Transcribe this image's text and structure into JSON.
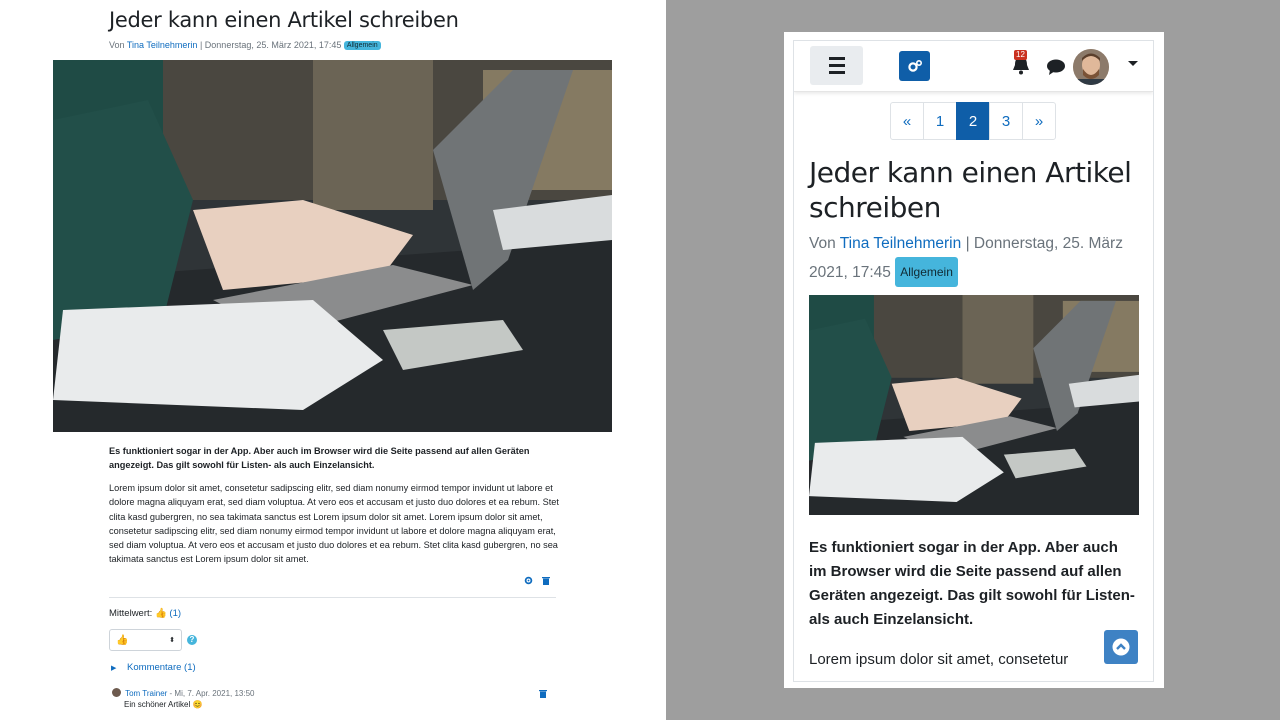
{
  "article": {
    "title": "Jeder kann einen Artikel schreiben",
    "by_prefix": "Von",
    "author": "Tina Teilnehmerin",
    "separator": "|",
    "date": "Donnerstag, 25. März 2021, 17:45",
    "category": "Allgemein",
    "lead": "Es funktioniert sogar in der App. Aber auch im Browser wird die Seite passend auf allen Geräten angezeigt. Das gilt sowohl für Listen- als auch Einzelansicht.",
    "body": "Lorem ipsum dolor sit amet, consetetur sadipscing elitr, sed diam nonumy eirmod tempor invidunt ut labore et dolore magna aliquyam erat, sed diam voluptua. At vero eos et accusam et justo duo dolores et ea rebum. Stet clita kasd gubergren, no sea takimata sanctus est Lorem ipsum dolor sit amet. Lorem ipsum dolor sit amet, consetetur sadipscing elitr, sed diam nonumy eirmod tempor invidunt ut labore et dolore magna aliquyam erat, sed diam voluptua. At vero eos et accusam et justo duo dolores et ea rebum. Stet clita kasd gubergren, no sea takimata sanctus est Lorem ipsum dolor sit amet.",
    "mobile_body_preview": "Lorem ipsum dolor sit amet, consetetur"
  },
  "rating": {
    "label": "Mittelwert:",
    "count": "(1)",
    "select_icon": "thumbs-up-icon",
    "help_icon": "question-circle-icon"
  },
  "comments": {
    "toggle_label": "Kommentare (1)",
    "items": [
      {
        "author": "Tom Trainer",
        "date": "- Mi, 7. Apr. 2021, 13:50",
        "text": "Ein schöner Artikel 😊"
      }
    ]
  },
  "mobile": {
    "notifications_count": "12",
    "pagination": [
      "«",
      "1",
      "2",
      "3",
      "»"
    ],
    "current_page": "2"
  },
  "colors": {
    "link": "#0f6cbf",
    "primary": "#0f5ea8",
    "badge": "#45b5dc",
    "notification": "#ca3120",
    "backdrop": "#9e9e9e"
  }
}
